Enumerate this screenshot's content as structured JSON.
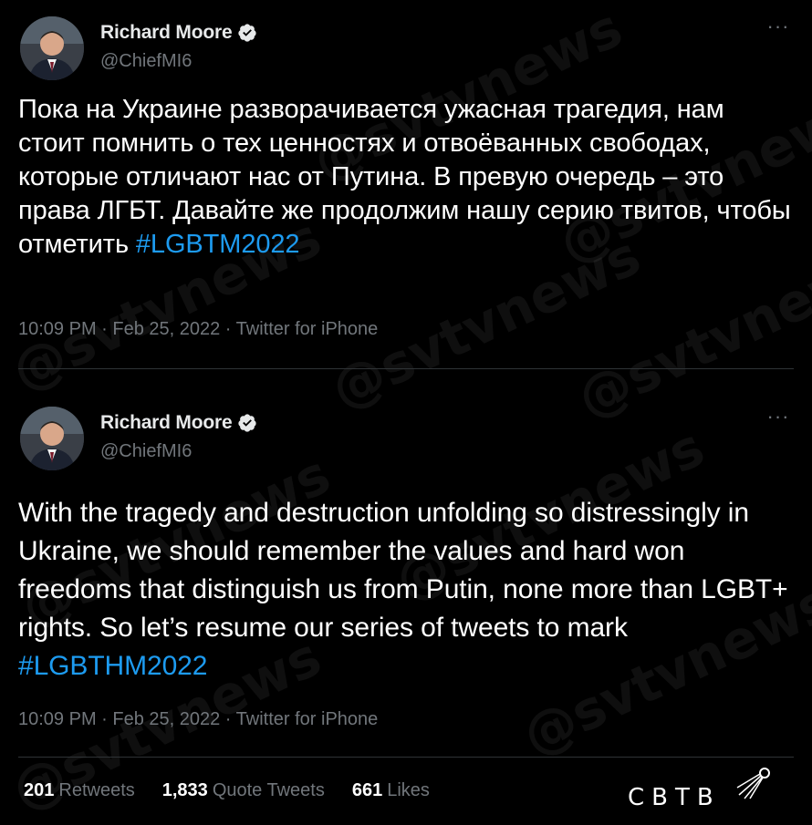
{
  "tweets": [
    {
      "author_name": "Richard Moore",
      "author_handle": "@ChiefMI6",
      "text_before": "Пока на Украине разворачивается ужасная трагедия, нам стоит помнить о тех ценностях и отвоёванных свободах, которые отличают нас от Путина. В превую очередь – это права ЛГБТ. Давайте же продолжим нашу серию твитов, чтобы отметить ",
      "hashtag": "#LGBTM2022",
      "meta": "10:09 PM · Feb 25, 2022 · Twitter for iPhone",
      "more_label": "···"
    },
    {
      "author_name": "Richard Moore",
      "author_handle": "@ChiefMI6",
      "text_before": "With the tragedy and destruction unfolding so distressingly in Ukraine, we should remember the values and hard won freedoms that distinguish us from Putin, none more than LGBT+ rights. So let’s resume our series of tweets to mark ",
      "hashtag": "#LGBTHM2022",
      "meta": "10:09 PM · Feb 25, 2022 · Twitter for iPhone",
      "more_label": "···"
    }
  ],
  "stats": {
    "retweets_count": "201",
    "retweets_label": "Retweets",
    "quotes_count": "1,833",
    "quotes_label": "Quote Tweets",
    "likes_count": "661",
    "likes_label": "Likes"
  },
  "logo": {
    "text": "СВТВ"
  },
  "watermark": {
    "text": "@svtvnews"
  },
  "colors": {
    "background": "#000000",
    "link": "#1d9bf0",
    "muted": "#71767b",
    "verified": "#e7e9ea"
  },
  "icons": [
    "verified-badge-icon",
    "more-options-icon",
    "avatar-portrait",
    "logo-sputnik-icon"
  ]
}
